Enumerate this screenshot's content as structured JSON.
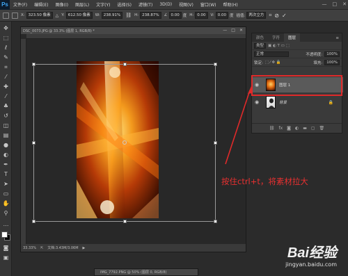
{
  "app": {
    "logo": "Ps"
  },
  "menu": [
    "文件(F)",
    "编辑(E)",
    "图像(I)",
    "图层(L)",
    "文字(Y)",
    "选择(S)",
    "滤镜(T)",
    "3D(D)",
    "视图(V)",
    "窗口(W)",
    "帮助(H)"
  ],
  "window_controls": [
    "—",
    "□",
    "✕"
  ],
  "options": {
    "x_label": "X:",
    "x_value": "323.50 像素",
    "y_label": "Y:",
    "y_value": "612.50 像素",
    "w_label": "W:",
    "w_value": "238.91%",
    "h_label": "H:",
    "h_value": "238.87%",
    "angle_value": "0.00",
    "angle_unit": "度",
    "h_skew_label": "H:",
    "h_skew_value": "0.00",
    "v_skew_label": "V:",
    "v_skew_value": "0.00",
    "skew_unit": "度",
    "interp_label": "插值:",
    "interp_value": "两次立方",
    "commit": "✓",
    "cancel": "⊘"
  },
  "document": {
    "tab_title": "DSC_0073.JPG @ 33.3% (图层 1, RGB/8) *",
    "zoom": "33.33%",
    "doc_info": "文档:3.43M/3.06M"
  },
  "document2": {
    "tab_title": "IMG_7792.PNG @ 50% (图层 0, RGB/8)"
  },
  "layers_panel": {
    "tabs": [
      "颜色",
      "字符",
      "图层"
    ],
    "active_tab": "图层",
    "kind_label": "类型",
    "blend_mode": "正常",
    "opacity_label": "不透明度:",
    "opacity_value": "100%",
    "lock_label": "锁定:",
    "fill_label": "填充:",
    "fill_value": "100%",
    "layers": [
      {
        "name": "图层 1",
        "selected": true
      },
      {
        "name": "背景",
        "locked": true
      }
    ]
  },
  "annotation": {
    "text": "按住ctrl+t，将素材拉大",
    "color": "#e83030"
  },
  "watermark": {
    "main": "Bai经验",
    "sub": "jingyan.baidu.com"
  },
  "colors": {
    "highlight": "#e02a2a",
    "ps_blue": "#3fa6f5"
  }
}
